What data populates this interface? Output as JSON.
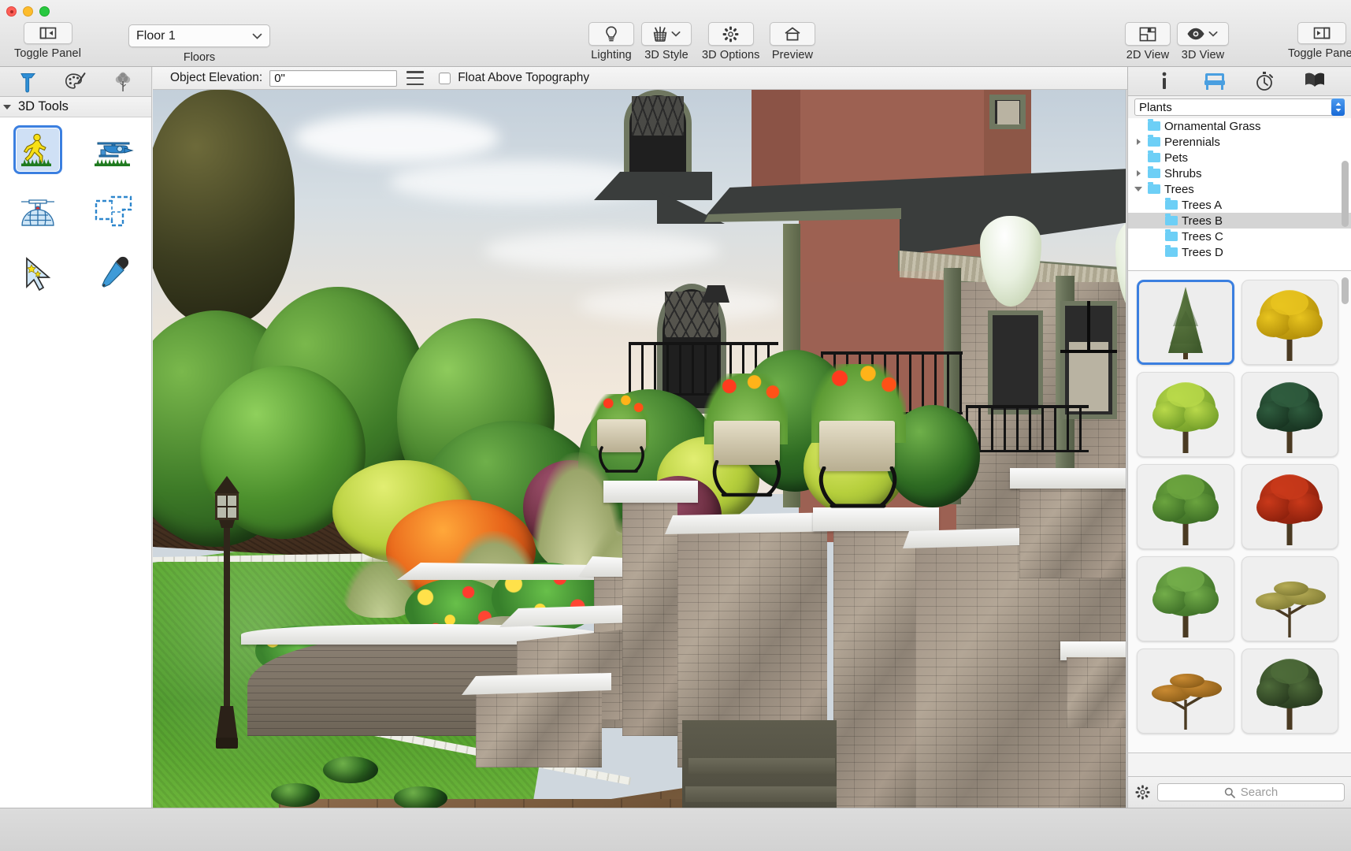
{
  "toolbar": {
    "toggle_panel_left": "Toggle Panel",
    "toggle_panel_right": "Toggle Panel",
    "floors_label": "Floors",
    "floors_value": "Floor 1",
    "lighting": "Lighting",
    "style_3d": "3D Style",
    "options_3d": "3D Options",
    "preview": "Preview",
    "view_2d": "2D View",
    "view_3d": "3D View"
  },
  "elevation_bar": {
    "label": "Object Elevation:",
    "value": "0\"",
    "placeholder": "0\"",
    "float_checkbox_label": "Float Above Topography",
    "float_checked": false
  },
  "left_panel": {
    "tabs": [
      {
        "name": "build-tab",
        "icon": "hammer-icon"
      },
      {
        "name": "materials-tab",
        "icon": "paint-palette-icon"
      },
      {
        "name": "plants-tab",
        "icon": "tree-icon"
      }
    ],
    "section_title": "3D Tools",
    "tools": [
      {
        "label": "Walkthrough",
        "icon": "walking-person-icon",
        "selected": true
      },
      {
        "label": "Fly Over",
        "icon": "helicopter-icon",
        "selected": false
      },
      {
        "label": "Full Overview",
        "icon": "satellite-dome-icon",
        "selected": false
      },
      {
        "label": "Framing Overview",
        "icon": "floorplan-overview-icon",
        "selected": false
      },
      {
        "label": "Select Objects",
        "icon": "magic-select-arrow-icon",
        "selected": false
      },
      {
        "label": "Eyedropper",
        "icon": "eyedropper-icon",
        "selected": false
      }
    ]
  },
  "right_panel": {
    "tabs": [
      {
        "name": "info-tab",
        "icon": "info-icon"
      },
      {
        "name": "library-tab",
        "icon": "armchair-icon",
        "active": true
      },
      {
        "name": "recent-tab",
        "icon": "stopwatch-icon"
      },
      {
        "name": "manual-tab",
        "icon": "open-book-icon"
      }
    ],
    "category": "Plants",
    "tree_items": [
      {
        "label": "Ornamental Grass",
        "depth": 1,
        "twisty": "none",
        "selected": false
      },
      {
        "label": "Perennials",
        "depth": 1,
        "twisty": "closed",
        "selected": false
      },
      {
        "label": "Pets",
        "depth": 1,
        "twisty": "none",
        "selected": false
      },
      {
        "label": "Shrubs",
        "depth": 1,
        "twisty": "closed",
        "selected": false
      },
      {
        "label": "Trees",
        "depth": 1,
        "twisty": "open",
        "selected": false
      },
      {
        "label": "Trees A",
        "depth": 2,
        "twisty": "none",
        "selected": false
      },
      {
        "label": "Trees B",
        "depth": 2,
        "twisty": "none",
        "selected": true
      },
      {
        "label": "Trees C",
        "depth": 2,
        "twisty": "none",
        "selected": false
      },
      {
        "label": "Trees D",
        "depth": 2,
        "twisty": "none",
        "selected": false
      }
    ],
    "thumbnails": [
      {
        "name": "conifer-spruce-thumb",
        "selected": true,
        "style": "conifer",
        "c1": "#6e8a4e",
        "c2": "#3f5a2c"
      },
      {
        "name": "yellow-maple-thumb",
        "selected": false,
        "style": "broad",
        "c1": "#e8c41f",
        "c2": "#b08c08"
      },
      {
        "name": "light-green-aspen-thumb",
        "selected": false,
        "style": "broad",
        "c1": "#b9d94a",
        "c2": "#6e9a27"
      },
      {
        "name": "dark-green-pine-thumb",
        "selected": false,
        "style": "broad",
        "c1": "#2f5c3e",
        "c2": "#16311f"
      },
      {
        "name": "green-oak-thumb",
        "selected": false,
        "style": "broad",
        "c1": "#6ba43f",
        "c2": "#3a6b24"
      },
      {
        "name": "red-maple-thumb",
        "selected": false,
        "style": "broad",
        "c1": "#c9391a",
        "c2": "#8a1f0c"
      },
      {
        "name": "green-birch-thumb",
        "selected": false,
        "style": "broad",
        "c1": "#73ad4a",
        "c2": "#3d6f27"
      },
      {
        "name": "acacia-autumn-thumb",
        "selected": false,
        "style": "umbrella",
        "c1": "#b6ac56",
        "c2": "#7f7a33"
      },
      {
        "name": "acacia-orange-thumb",
        "selected": false,
        "style": "umbrella",
        "c1": "#c98a32",
        "c2": "#8a5c18"
      },
      {
        "name": "dense-dark-tree-thumb",
        "selected": false,
        "style": "broad",
        "c1": "#4e6b3a",
        "c2": "#26381d"
      }
    ],
    "search_placeholder": "Search",
    "gear_icon": "gear-icon",
    "search_icon": "search-icon"
  },
  "viewport": {
    "name": "3d-render-view",
    "scene_description": "Exterior landscape rendering of a house front entry with stone retaining walls, planters and lawn",
    "colors": {
      "house_stucco": "#9d6152",
      "roof": "#3a3d3c",
      "beam_timber": "#6f7760",
      "lawn_green": "#4e9b2b",
      "paver_brown": "#6e5236",
      "cap_stone": "#f2f2ef",
      "mulch": "#3c2a1c"
    }
  },
  "window": {
    "accent": "#3b7fe0"
  }
}
